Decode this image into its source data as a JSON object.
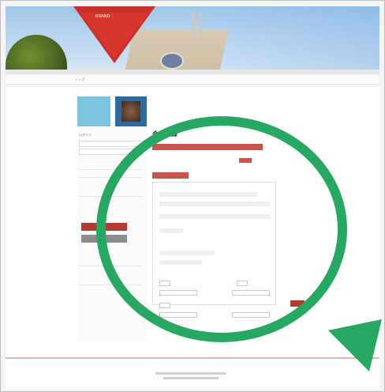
{
  "header": {
    "brand_text": "BRAND",
    "right_text": ""
  },
  "nav": {
    "breadcrumb": "トップ"
  },
  "sidebar": {
    "label_1": "ログイン",
    "link_1": "",
    "link_2": "",
    "link_3": ""
  },
  "main": {
    "title": "会員登録",
    "subtitle": ""
  },
  "colors": {
    "accent_red": "#c6554a",
    "lens_green": "#26a862"
  },
  "icons": {
    "magnifier": "magnifier-icon"
  }
}
